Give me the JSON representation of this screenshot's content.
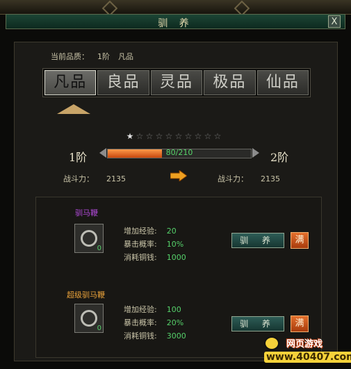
{
  "window": {
    "title": "驯 养",
    "close_label": "X"
  },
  "quality": {
    "label": "当前品质：",
    "level": "1阶",
    "name": "凡品"
  },
  "tabs": [
    {
      "label": "凡品",
      "active": true
    },
    {
      "label": "良品",
      "active": false
    },
    {
      "label": "灵品",
      "active": false
    },
    {
      "label": "极品",
      "active": false
    },
    {
      "label": "仙品",
      "active": false
    }
  ],
  "stars": {
    "filled": 1,
    "total": 10
  },
  "progress": {
    "from_level": "1阶",
    "to_level": "2阶",
    "text": "80/210",
    "value": 80,
    "max": 210
  },
  "power": {
    "label": "战斗力：",
    "current": "2135",
    "next": "2135"
  },
  "items": [
    {
      "name": "驯马鞭",
      "name_color": "#b04ad8",
      "count": "0",
      "stats": [
        {
          "label": "增加经验:",
          "value": "20"
        },
        {
          "label": "暴击概率:",
          "value": "10%"
        },
        {
          "label": "消耗铜钱:",
          "value": "1000"
        }
      ],
      "train_label": "驯 养",
      "max_label": "满"
    },
    {
      "name": "超级驯马鞭",
      "name_color": "#e8a13a",
      "count": "0",
      "stats": [
        {
          "label": "增加经验:",
          "value": "100"
        },
        {
          "label": "暴击概率:",
          "value": "20%"
        },
        {
          "label": "消耗铜钱:",
          "value": "3000"
        }
      ],
      "train_label": "驯 养",
      "max_label": "满"
    }
  ],
  "watermark": {
    "line1": "网页游戏",
    "line2": "www.40407.com"
  }
}
